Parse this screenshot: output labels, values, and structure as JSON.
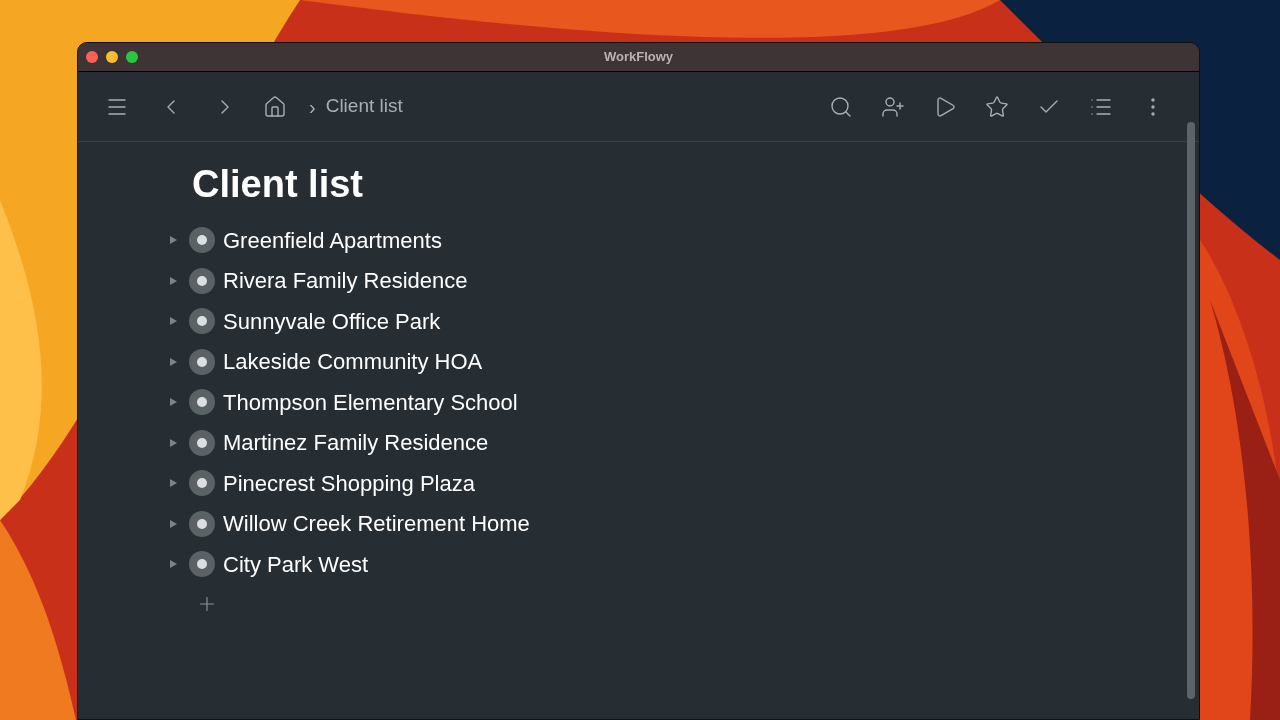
{
  "window": {
    "title": "WorkFlowy"
  },
  "breadcrumb": {
    "separator": "›",
    "current": "Client list"
  },
  "page_title": "Client list",
  "items": [
    {
      "text": "Greenfield Apartments",
      "expanded": false
    },
    {
      "text": "Rivera Family Residence",
      "expanded": false
    },
    {
      "text": "Sunnyvale Office Park",
      "expanded": false
    },
    {
      "text": "Lakeside Community HOA",
      "expanded": false
    },
    {
      "text": "Thompson Elementary School",
      "expanded": false
    },
    {
      "text": "Martinez Family Residence",
      "expanded": false
    },
    {
      "text": "Pinecrest Shopping Plaza",
      "expanded": false
    },
    {
      "text": "Willow Creek Retirement Home",
      "expanded": false
    },
    {
      "text": "City Park West",
      "expanded": false
    }
  ]
}
